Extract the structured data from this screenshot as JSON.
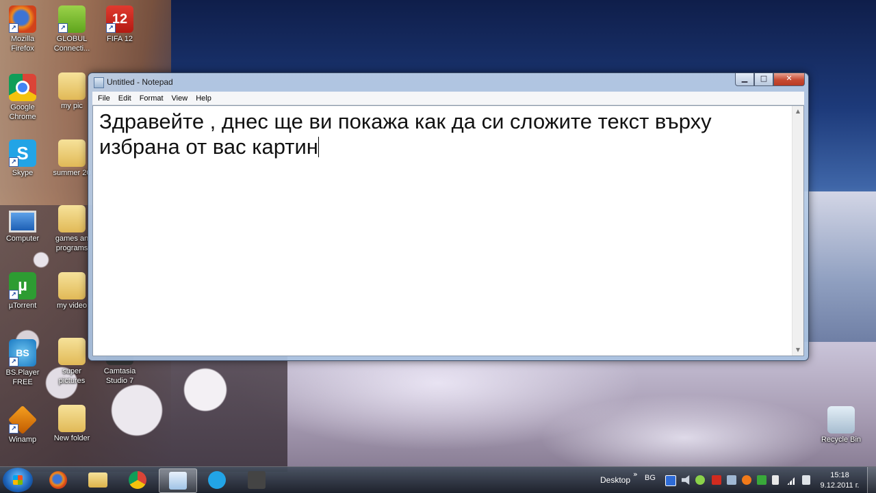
{
  "desktop": {
    "icons": [
      {
        "label": "Mozilla Firefox",
        "icon": "firefox-icon"
      },
      {
        "label": "GLOBUL Connecti...",
        "icon": "globul-icon"
      },
      {
        "label": "FIFA 12",
        "icon": "fifa-icon",
        "badge": "12"
      },
      {
        "label": "Google Chrome",
        "icon": "chrome-icon"
      },
      {
        "label": "my pic",
        "icon": "folder-icon"
      },
      {
        "label": "Skype",
        "icon": "skype-icon",
        "glyph": "S"
      },
      {
        "label": "summer 20",
        "icon": "folder-icon"
      },
      {
        "label": "Computer",
        "icon": "computer-icon"
      },
      {
        "label": "games an programs",
        "icon": "folder-icon"
      },
      {
        "label": "µTorrent",
        "icon": "utorrent-icon",
        "glyph": "µ"
      },
      {
        "label": "my video",
        "icon": "folder-icon"
      },
      {
        "label": "BS.Player FREE",
        "icon": "bsplayer-icon",
        "glyph": "BS"
      },
      {
        "label": "super pictures",
        "icon": "folder-icon"
      },
      {
        "label": "Camtasia Studio 7",
        "icon": "camtasia-icon"
      },
      {
        "label": "Winamp",
        "icon": "winamp-icon"
      },
      {
        "label": "New folder",
        "icon": "folder-icon"
      },
      {
        "label": "Recycle Bin",
        "icon": "recycle-bin-icon"
      }
    ]
  },
  "notepad": {
    "title": "Untitled - Notepad",
    "controls": {
      "minimize": "▁",
      "maximize": "□",
      "close": "✕"
    },
    "menu": [
      "File",
      "Edit",
      "Format",
      "View",
      "Help"
    ],
    "text": "Здравейте , днес ще ви покажа как да си сложите текст върху\nизбрана от вас картин",
    "scroll_up": "▲",
    "scroll_down": "▼"
  },
  "taskbar": {
    "apps": [
      {
        "name": "firefox",
        "icon": "firefox-icon"
      },
      {
        "name": "windows-explorer",
        "icon": "folder-icon"
      },
      {
        "name": "chrome",
        "icon": "chrome-icon"
      },
      {
        "name": "notepad",
        "icon": "notepad-icon",
        "active": true
      },
      {
        "name": "skype",
        "icon": "skype-icon"
      },
      {
        "name": "camtasia",
        "icon": "camtasia-icon"
      }
    ],
    "desktop_label": "Desktop",
    "chevron": "»",
    "language": "BG",
    "time": "15:18",
    "date": "9.12.2011 г."
  }
}
